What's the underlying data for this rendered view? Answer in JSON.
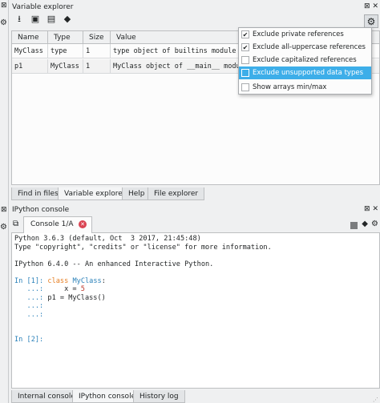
{
  "variable_explorer": {
    "title": "Variable explorer",
    "pane_buttons": "⊠ ✕",
    "toolbar_icons": [
      "download-icon",
      "save-icon",
      "save-as-icon",
      "eraser-icon"
    ],
    "table": {
      "columns": [
        "Name",
        "Type",
        "Size",
        "Value"
      ],
      "rows": [
        {
          "name": "MyClass",
          "type": "type",
          "size": "1",
          "value": "type object of builtins module"
        },
        {
          "name": "p1",
          "type": "MyClass",
          "size": "1",
          "value": "MyClass object of __main__ module"
        }
      ]
    }
  },
  "options_menu": {
    "items": [
      {
        "label": "Exclude private references",
        "checked": true,
        "highlighted": false
      },
      {
        "label": "Exclude all-uppercase references",
        "checked": true,
        "highlighted": false
      },
      {
        "label": "Exclude capitalized references",
        "checked": false,
        "highlighted": false
      },
      {
        "label": "Exclude unsupported data types",
        "checked": false,
        "highlighted": true
      },
      {
        "label": "Show arrays min/max",
        "checked": false,
        "highlighted": false
      }
    ]
  },
  "upper_tabs": [
    "Find in files",
    "Variable explorer",
    "Help",
    "File explorer"
  ],
  "ipython": {
    "title": "IPython console",
    "tab_label": "Console 1/A",
    "lines": [
      "Python 3.6.3 (default, Oct  3 2017, 21:45:48)",
      "Type \"copyright\", \"credits\" or \"license\" for more information.",
      "",
      "IPython 6.4.0 -- An enhanced Interactive Python.",
      "",
      "In [1]: class MyClass:",
      "   ...:     x = 5",
      "   ...: p1 = MyClass()",
      "   ...:",
      "   ...:",
      "",
      "",
      "In [2]:"
    ]
  },
  "lower_tabs": [
    "Internal console",
    "IPython console",
    "History log"
  ]
}
